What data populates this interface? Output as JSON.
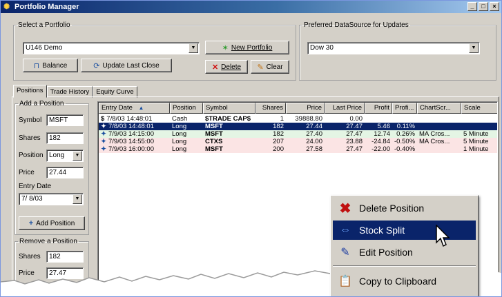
{
  "window": {
    "title": "Portfolio Manager",
    "min_btn": "_",
    "max_btn": "□",
    "close_btn": "×"
  },
  "select_group": {
    "legend": "Select a Portfolio",
    "portfolio_value": "U146 Demo",
    "new_portfolio": "New Portfolio",
    "balance": "Balance",
    "update_last_close": "Update Last Close",
    "delete": "Delete",
    "clear": "Clear"
  },
  "datasource_group": {
    "legend": "Preferred DataSource for Updates",
    "value": "Dow 30"
  },
  "tabs": [
    "Positions",
    "Trade History",
    "Equity Curve"
  ],
  "add_position": {
    "legend": "Add a Position",
    "symbol_label": "Symbol",
    "symbol_value": "MSFT",
    "shares_label": "Shares",
    "shares_value": "182",
    "position_label": "Position",
    "position_value": "Long",
    "price_label": "Price",
    "price_value": "27.44",
    "entry_date_label": "Entry Date",
    "entry_date_value": "7/ 8/03",
    "add_button": "Add Position"
  },
  "remove_position": {
    "legend": "Remove a Position",
    "shares_label": "Shares",
    "shares_value": "182",
    "price_label": "Price",
    "price_value": "27.47"
  },
  "grid": {
    "headers": [
      "Entry Date",
      "Position",
      "Symbol",
      "Shares",
      "Price",
      "Last Price",
      "Profit",
      "Profi...",
      "ChartScr...",
      "Scale"
    ],
    "sort_indicator": "▲",
    "rows": [
      {
        "icon": "$",
        "date": "7/8/03 14:48:01",
        "position": "Cash",
        "symbol": "$TRADE CAP$",
        "shares": "1",
        "price": "39888.80",
        "last": "0.00",
        "profit": "",
        "pct": "",
        "chart": "",
        "scale": "",
        "style": "normal"
      },
      {
        "icon": "✦",
        "date": "7/8/03 14:48:01",
        "position": "Long",
        "symbol": "MSFT",
        "shares": "182",
        "price": "27.44",
        "last": "27.47",
        "profit": "5.46",
        "pct": "0.11%",
        "chart": "",
        "scale": "",
        "style": "selected"
      },
      {
        "icon": "✦",
        "date": "7/9/03 14:15:00",
        "position": "Long",
        "symbol": "MSFT",
        "shares": "182",
        "price": "27.40",
        "last": "27.47",
        "profit": "12.74",
        "pct": "0.26%",
        "chart": "MA Cros...",
        "scale": "5 Minute",
        "style": "greenish"
      },
      {
        "icon": "✦",
        "date": "7/9/03 14:55:00",
        "position": "Long",
        "symbol": "CTXS",
        "shares": "207",
        "price": "24.00",
        "last": "23.88",
        "profit": "-24.84",
        "pct": "-0.50%",
        "chart": "MA Cros...",
        "scale": "5 Minute",
        "style": "pinkish"
      },
      {
        "icon": "✦",
        "date": "7/9/03 16:00:00",
        "position": "Long",
        "symbol": "MSFT",
        "shares": "200",
        "price": "27.58",
        "last": "27.47",
        "profit": "-22.00",
        "pct": "-0.40%",
        "chart": "",
        "scale": "1 Minute",
        "style": "pinkish"
      }
    ]
  },
  "context_menu": {
    "items": [
      "Delete Position",
      "Stock Split",
      "Edit Position",
      "Copy to Clipboard"
    ]
  },
  "colors": {
    "title_bar": "#0a246a",
    "selection": "#0a246a",
    "face": "#d4d0c8"
  }
}
